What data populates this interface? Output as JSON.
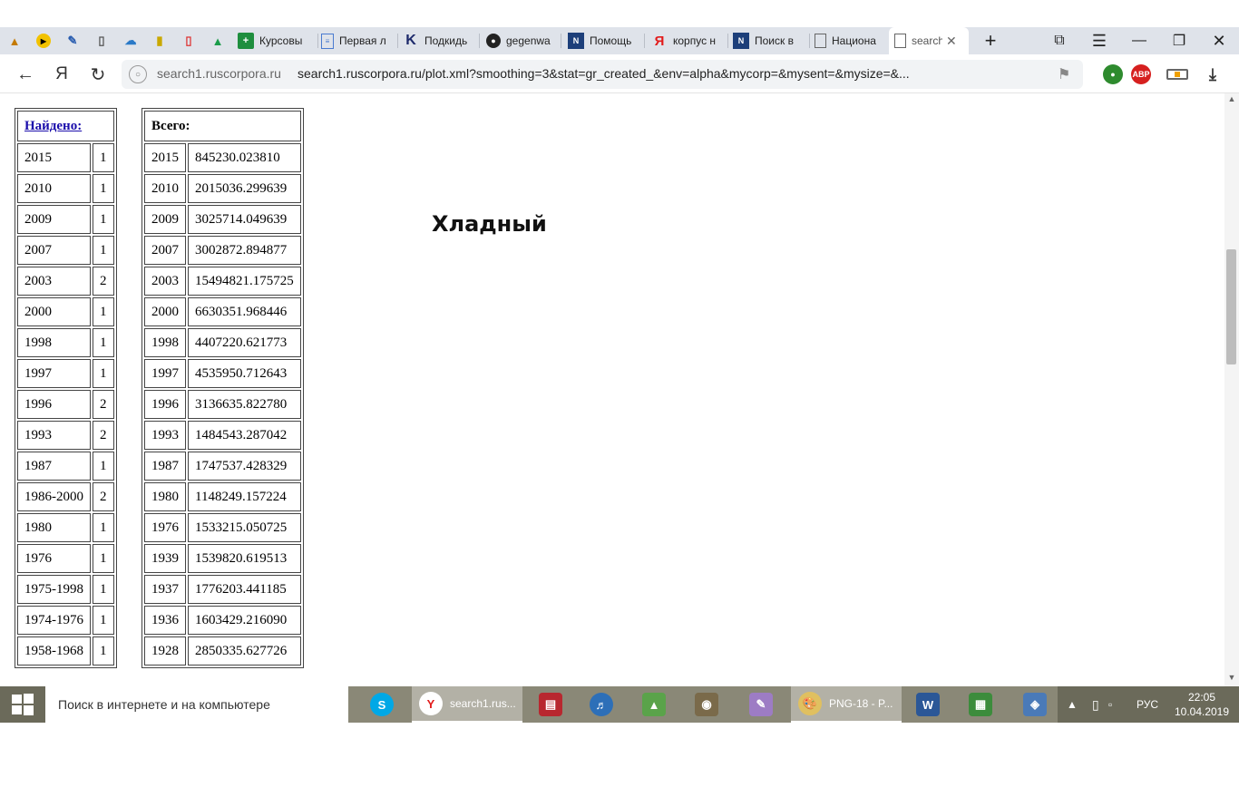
{
  "browser": {
    "tabs": [
      {
        "label": "Курсовы",
        "icon": "plus-icon"
      },
      {
        "label": "Первая л",
        "icon": "document-icon"
      },
      {
        "label": "Подкидь",
        "icon": "k-icon"
      },
      {
        "label": "gegenwa",
        "icon": "github-icon"
      },
      {
        "label": "Помощь",
        "icon": "corpus-icon"
      },
      {
        "label": "корпус н",
        "icon": "yandex-icon"
      },
      {
        "label": "Поиск в",
        "icon": "corpus-icon"
      },
      {
        "label": "Национа",
        "icon": "page-icon"
      },
      {
        "label": "search",
        "icon": "page-icon"
      }
    ],
    "address": {
      "host": "search1.ruscorpora.ru",
      "url": "search1.ruscorpora.ru/plot.xml?smoothing=3&stat=gr_created_&env=alpha&mycorp=&mysent=&mysize=&..."
    },
    "abp_label": "ABP"
  },
  "found_table": {
    "header": "Найдено:",
    "rows": [
      [
        "2015",
        "1"
      ],
      [
        "2010",
        "1"
      ],
      [
        "2009",
        "1"
      ],
      [
        "2007",
        "1"
      ],
      [
        "2003",
        "2"
      ],
      [
        "2000",
        "1"
      ],
      [
        "1998",
        "1"
      ],
      [
        "1997",
        "1"
      ],
      [
        "1996",
        "2"
      ],
      [
        "1993",
        "2"
      ],
      [
        "1987",
        "1"
      ],
      [
        "1986-2000",
        "2"
      ],
      [
        "1980",
        "1"
      ],
      [
        "1976",
        "1"
      ],
      [
        "1975-1998",
        "1"
      ],
      [
        "1974-1976",
        "1"
      ],
      [
        "1958-1968",
        "1"
      ]
    ]
  },
  "total_table": {
    "header": "Всего:",
    "rows": [
      [
        "2015",
        "845230.023810"
      ],
      [
        "2010",
        "2015036.299639"
      ],
      [
        "2009",
        "3025714.049639"
      ],
      [
        "2007",
        "3002872.894877"
      ],
      [
        "2003",
        "15494821.175725"
      ],
      [
        "2000",
        "6630351.968446"
      ],
      [
        "1998",
        "4407220.621773"
      ],
      [
        "1997",
        "4535950.712643"
      ],
      [
        "1996",
        "3136635.822780"
      ],
      [
        "1993",
        "1484543.287042"
      ],
      [
        "1987",
        "1747537.428329"
      ],
      [
        "1980",
        "1148249.157224"
      ],
      [
        "1976",
        "1533215.050725"
      ],
      [
        "1939",
        "1539820.619513"
      ],
      [
        "1937",
        "1776203.441185"
      ],
      [
        "1936",
        "1603429.216090"
      ],
      [
        "1928",
        "2850335.627726"
      ]
    ]
  },
  "plot": {
    "title": "Хладный"
  },
  "taskbar": {
    "search_placeholder": "Поиск в интернете и на компьютере",
    "browser_task_label": "search1.rus...",
    "png_task_label": "PNG-18 - P...",
    "lang": "РУС",
    "time": "22:05",
    "date": "10.04.2019"
  }
}
